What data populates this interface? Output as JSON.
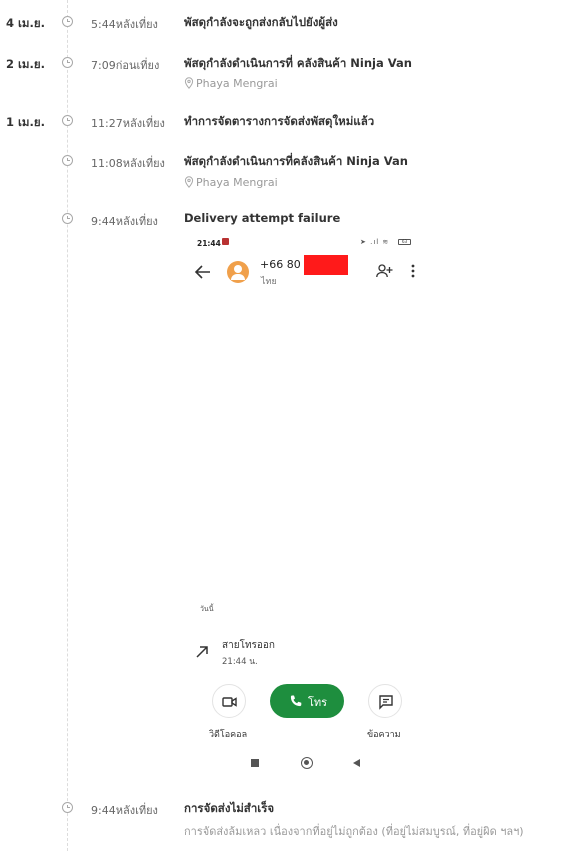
{
  "events": [
    {
      "date": "4 เม.ย.",
      "time": "5:44หลังเที่ยง",
      "title": "พัสดุกำลังจะถูกส่งกลับไปยังผู้ส่ง",
      "location": ""
    },
    {
      "date": "2 เม.ย.",
      "time": "7:09ก่อนเที่ยง",
      "title": "พัสดุกำลังดำเนินการที่ คลังสินค้า Ninja Van",
      "location": "Phaya Mengrai"
    },
    {
      "date": "1 เม.ย.",
      "time": "11:27หลังเที่ยง",
      "title": "ทำการจัดตารางการจัดส่งพัสดุใหม่แล้ว",
      "location": ""
    },
    {
      "date": "",
      "time": "11:08หลังเที่ยง",
      "title": "พัสดุกำลังดำเนินการที่คลังสินค้า Ninja Van",
      "location": "Phaya Mengrai"
    },
    {
      "date": "",
      "time": "9:44หลังเที่ยง",
      "title": "Delivery attempt failure",
      "location": ""
    },
    {
      "date": "",
      "time": "9:44หลังเที่ยง",
      "title": "การจัดส่งไม่สำเร็จ",
      "description": "การจัดส่งล้มเหลว เนื่องจากที่อยู่ไม่ถูกต้อง (ที่อยู่ไม่สมบูรณ์, ที่อยู่ผิด ฯลฯ)"
    }
  ],
  "phone": {
    "status_time": "21:44",
    "status_right": "➤ .ıl ≋",
    "battery": "63",
    "contact_number": "+66 80 5",
    "contact_region": "ไทย",
    "day_label": "วันนี้",
    "call_type": "สายโทรออก",
    "call_time": "21:44 น.",
    "call_button_label": "โทร",
    "video_call_label": "วิดีโอคอล",
    "message_label": "ข้อความ",
    "redaction_color": "#ff1a1a",
    "call_button_color": "#1e8e3e",
    "avatar_color": "#f0a04b"
  }
}
